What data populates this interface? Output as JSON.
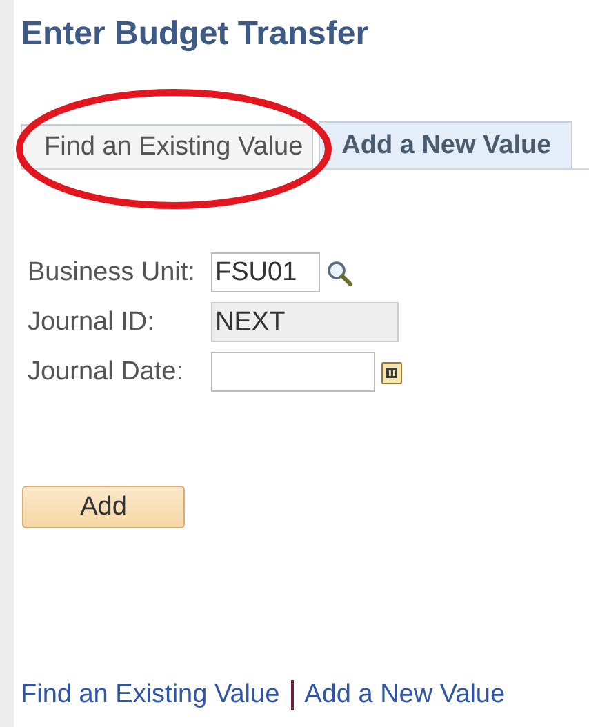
{
  "page_title": "Enter Budget Transfer",
  "tabs": [
    {
      "label": "Find an Existing Value",
      "selected": false
    },
    {
      "label": "Add a New Value",
      "selected": true
    }
  ],
  "annotation": {
    "kind": "ellipse"
  },
  "fields": [
    {
      "label": "Business Unit:",
      "kind": "lookup",
      "value": "FSU01",
      "disabled": false
    },
    {
      "label": "Journal ID:",
      "kind": "text",
      "value": "NEXT",
      "disabled": true
    },
    {
      "label": "Journal Date:",
      "kind": "date",
      "disabled": false
    }
  ],
  "add_button": "Add",
  "footer_links": [
    "Find an Existing Value",
    "Add a New Value"
  ]
}
